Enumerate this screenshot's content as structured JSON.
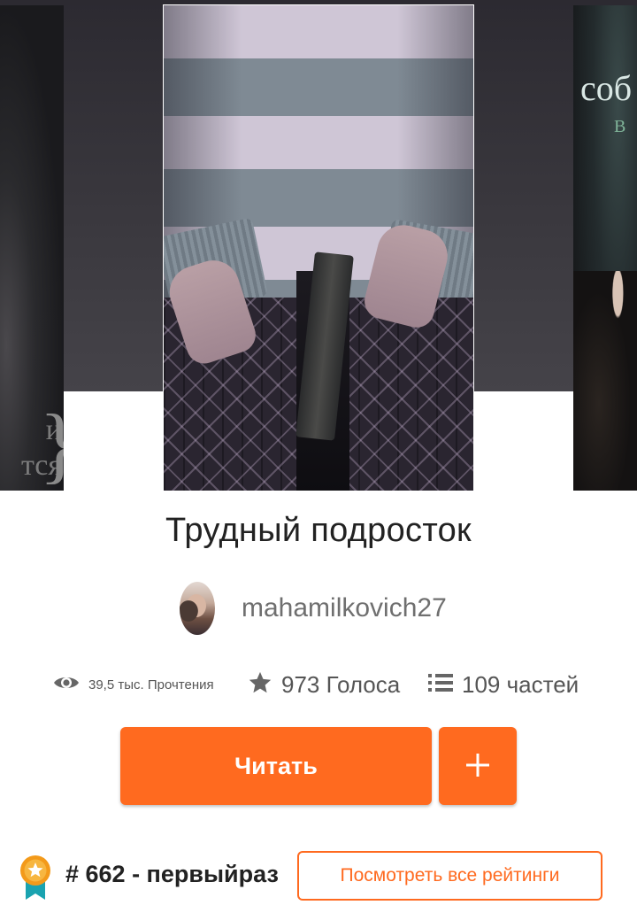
{
  "story": {
    "title": "Трудный подросток",
    "author": "mahamilkovich27"
  },
  "covers": {
    "left_text": "и\nтся",
    "right_text": "соб",
    "right_sub": "В"
  },
  "stats": {
    "reads": "39,5 тыс. Прочтения",
    "votes": "973 Голоса",
    "parts": "109 частей"
  },
  "actions": {
    "read_label": "Читать",
    "add_label": "+"
  },
  "ranking": {
    "rank_text": "# 662 - первыйраз",
    "view_all_label": "Посмотреть все рейтинги"
  },
  "colors": {
    "accent": "#ff6a1f",
    "text": "#222222",
    "muted": "#6f6f6f"
  },
  "icons": {
    "reads": "eye-icon",
    "votes": "star-icon",
    "parts": "list-icon",
    "rank": "medal-icon",
    "add": "plus-icon"
  }
}
